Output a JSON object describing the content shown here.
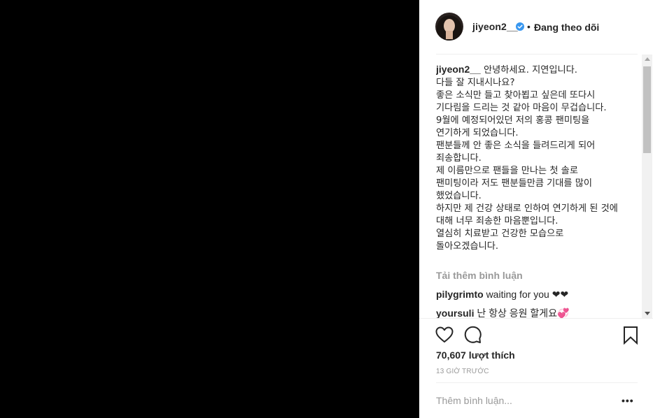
{
  "post": {
    "username": "jiyeon2__",
    "verified": true,
    "follow_separator": "•",
    "follow_status": "Đang theo dõi",
    "caption_text": "안녕하세요. 지연입니다.\n다들 잘 지내시나요?\n좋은 소식만 들고 찾아뵙고 싶은데 또다시 기다림을 드리는 것 같아 마음이 무겁습니다.\n9월에 예정되어있던 저의 홍콩 팬미팅을 연기하게 되었습니다.\n팬분들께 안 좋은 소식을 들려드리게 되어 죄송합니다.\n제 이름만으로 팬들을 만나는 첫 솔로 팬미팅이라 저도 팬분들만큼 기대를 많이 했었습니다.\n하지만 제 건강 상태로 인하여 연기하게 된 것에 대해 너무 죄송한 마음뿐입니다.\n열심히 치료받고 건강한 모습으로 돌아오겠습니다.",
    "load_more": "Tải thêm bình luận",
    "comments": [
      {
        "username": "pilygrimto",
        "text": "waiting for you ❤❤"
      },
      {
        "username": "yoursuli",
        "text": "난 항상 응원 할게요💞"
      }
    ],
    "likes": "70,607 lượt thích",
    "timestamp": "13 GIỜ TRƯỚC",
    "comment_placeholder": "Thêm bình luận...",
    "more_label": "•••"
  },
  "icons": {
    "like": "heart-icon",
    "comment": "comment-bubble-icon",
    "save": "bookmark-icon",
    "verified": "verified-badge-icon",
    "more": "more-options-icon"
  },
  "colors": {
    "verified": "#3897f0",
    "text": "#262626",
    "muted": "#999999",
    "media_background": "#000000"
  }
}
